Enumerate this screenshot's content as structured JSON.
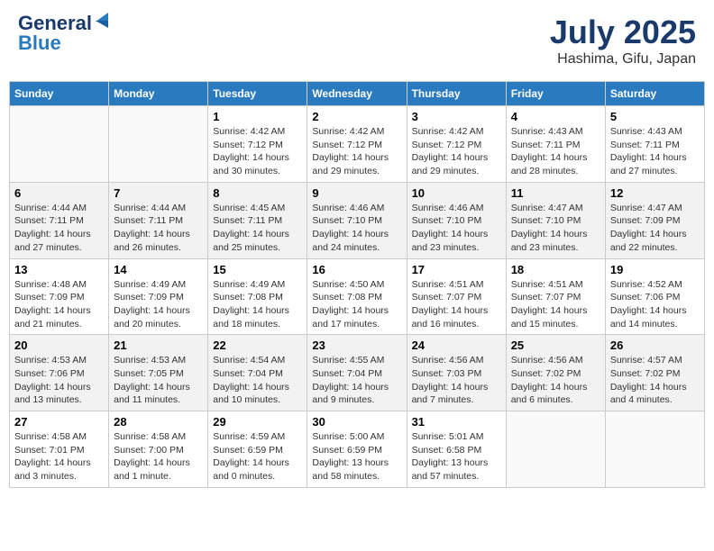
{
  "header": {
    "logo_line1": "General",
    "logo_line2": "Blue",
    "month": "July 2025",
    "location": "Hashima, Gifu, Japan"
  },
  "weekdays": [
    "Sunday",
    "Monday",
    "Tuesday",
    "Wednesday",
    "Thursday",
    "Friday",
    "Saturday"
  ],
  "weeks": [
    [
      {
        "day": "",
        "info": ""
      },
      {
        "day": "",
        "info": ""
      },
      {
        "day": "1",
        "info": "Sunrise: 4:42 AM\nSunset: 7:12 PM\nDaylight: 14 hours\nand 30 minutes."
      },
      {
        "day": "2",
        "info": "Sunrise: 4:42 AM\nSunset: 7:12 PM\nDaylight: 14 hours\nand 29 minutes."
      },
      {
        "day": "3",
        "info": "Sunrise: 4:42 AM\nSunset: 7:12 PM\nDaylight: 14 hours\nand 29 minutes."
      },
      {
        "day": "4",
        "info": "Sunrise: 4:43 AM\nSunset: 7:11 PM\nDaylight: 14 hours\nand 28 minutes."
      },
      {
        "day": "5",
        "info": "Sunrise: 4:43 AM\nSunset: 7:11 PM\nDaylight: 14 hours\nand 27 minutes."
      }
    ],
    [
      {
        "day": "6",
        "info": "Sunrise: 4:44 AM\nSunset: 7:11 PM\nDaylight: 14 hours\nand 27 minutes."
      },
      {
        "day": "7",
        "info": "Sunrise: 4:44 AM\nSunset: 7:11 PM\nDaylight: 14 hours\nand 26 minutes."
      },
      {
        "day": "8",
        "info": "Sunrise: 4:45 AM\nSunset: 7:11 PM\nDaylight: 14 hours\nand 25 minutes."
      },
      {
        "day": "9",
        "info": "Sunrise: 4:46 AM\nSunset: 7:10 PM\nDaylight: 14 hours\nand 24 minutes."
      },
      {
        "day": "10",
        "info": "Sunrise: 4:46 AM\nSunset: 7:10 PM\nDaylight: 14 hours\nand 23 minutes."
      },
      {
        "day": "11",
        "info": "Sunrise: 4:47 AM\nSunset: 7:10 PM\nDaylight: 14 hours\nand 23 minutes."
      },
      {
        "day": "12",
        "info": "Sunrise: 4:47 AM\nSunset: 7:09 PM\nDaylight: 14 hours\nand 22 minutes."
      }
    ],
    [
      {
        "day": "13",
        "info": "Sunrise: 4:48 AM\nSunset: 7:09 PM\nDaylight: 14 hours\nand 21 minutes."
      },
      {
        "day": "14",
        "info": "Sunrise: 4:49 AM\nSunset: 7:09 PM\nDaylight: 14 hours\nand 20 minutes."
      },
      {
        "day": "15",
        "info": "Sunrise: 4:49 AM\nSunset: 7:08 PM\nDaylight: 14 hours\nand 18 minutes."
      },
      {
        "day": "16",
        "info": "Sunrise: 4:50 AM\nSunset: 7:08 PM\nDaylight: 14 hours\nand 17 minutes."
      },
      {
        "day": "17",
        "info": "Sunrise: 4:51 AM\nSunset: 7:07 PM\nDaylight: 14 hours\nand 16 minutes."
      },
      {
        "day": "18",
        "info": "Sunrise: 4:51 AM\nSunset: 7:07 PM\nDaylight: 14 hours\nand 15 minutes."
      },
      {
        "day": "19",
        "info": "Sunrise: 4:52 AM\nSunset: 7:06 PM\nDaylight: 14 hours\nand 14 minutes."
      }
    ],
    [
      {
        "day": "20",
        "info": "Sunrise: 4:53 AM\nSunset: 7:06 PM\nDaylight: 14 hours\nand 13 minutes."
      },
      {
        "day": "21",
        "info": "Sunrise: 4:53 AM\nSunset: 7:05 PM\nDaylight: 14 hours\nand 11 minutes."
      },
      {
        "day": "22",
        "info": "Sunrise: 4:54 AM\nSunset: 7:04 PM\nDaylight: 14 hours\nand 10 minutes."
      },
      {
        "day": "23",
        "info": "Sunrise: 4:55 AM\nSunset: 7:04 PM\nDaylight: 14 hours\nand 9 minutes."
      },
      {
        "day": "24",
        "info": "Sunrise: 4:56 AM\nSunset: 7:03 PM\nDaylight: 14 hours\nand 7 minutes."
      },
      {
        "day": "25",
        "info": "Sunrise: 4:56 AM\nSunset: 7:02 PM\nDaylight: 14 hours\nand 6 minutes."
      },
      {
        "day": "26",
        "info": "Sunrise: 4:57 AM\nSunset: 7:02 PM\nDaylight: 14 hours\nand 4 minutes."
      }
    ],
    [
      {
        "day": "27",
        "info": "Sunrise: 4:58 AM\nSunset: 7:01 PM\nDaylight: 14 hours\nand 3 minutes."
      },
      {
        "day": "28",
        "info": "Sunrise: 4:58 AM\nSunset: 7:00 PM\nDaylight: 14 hours\nand 1 minute."
      },
      {
        "day": "29",
        "info": "Sunrise: 4:59 AM\nSunset: 6:59 PM\nDaylight: 14 hours\nand 0 minutes."
      },
      {
        "day": "30",
        "info": "Sunrise: 5:00 AM\nSunset: 6:59 PM\nDaylight: 13 hours\nand 58 minutes."
      },
      {
        "day": "31",
        "info": "Sunrise: 5:01 AM\nSunset: 6:58 PM\nDaylight: 13 hours\nand 57 minutes."
      },
      {
        "day": "",
        "info": ""
      },
      {
        "day": "",
        "info": ""
      }
    ]
  ]
}
